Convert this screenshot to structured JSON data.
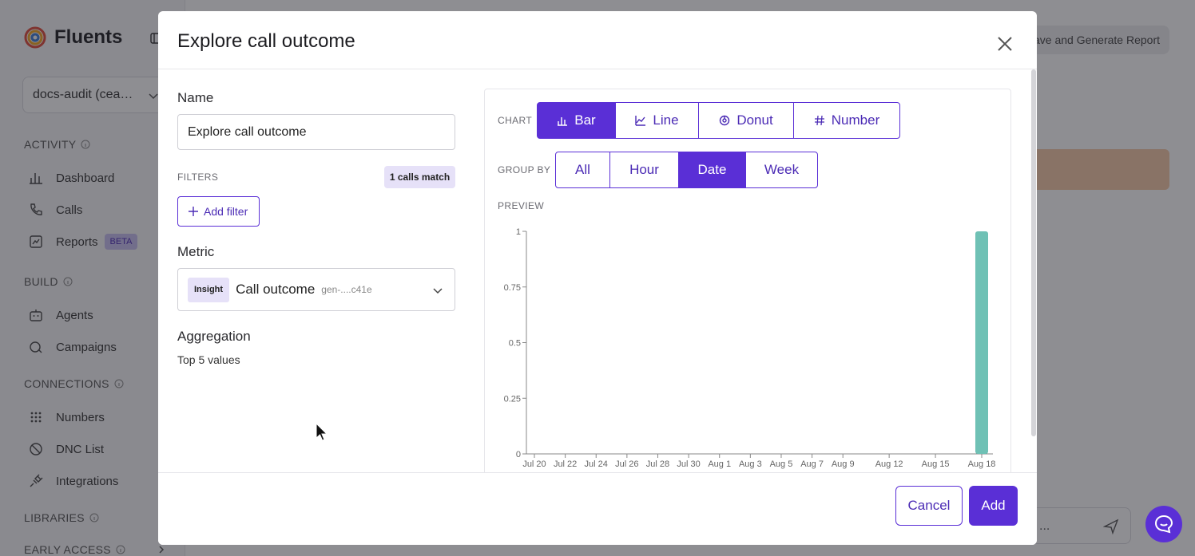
{
  "app": {
    "brand": "Fluents",
    "workspace": "docs-audit (cea…",
    "sections": [
      {
        "label": "ACTIVITY",
        "items": [
          {
            "label": "Dashboard"
          },
          {
            "label": "Calls"
          },
          {
            "label": "Reports",
            "badge": "BETA"
          }
        ]
      },
      {
        "label": "BUILD",
        "items": [
          {
            "label": "Agents"
          },
          {
            "label": "Campaigns"
          }
        ]
      },
      {
        "label": "CONNECTIONS",
        "items": [
          {
            "label": "Numbers"
          },
          {
            "label": "DNC List"
          },
          {
            "label": "Integrations"
          }
        ]
      },
      {
        "label": "LIBRARIES",
        "items": []
      },
      {
        "label": "EARLY ACCESS",
        "items": []
      }
    ],
    "header_button": "ave and Generate Report",
    "chat_input_placeholder": "..."
  },
  "modal": {
    "title": "Explore call outcome",
    "name_label": "Name",
    "name_value": "Explore call outcome",
    "filters_label": "FILTERS",
    "match_badge": "1 calls match",
    "add_filter_label": "Add filter",
    "metric_label": "Metric",
    "metric_tag": "Insight",
    "metric_name": "Call outcome",
    "metric_id": "gen-....c41e",
    "aggregation_label": "Aggregation",
    "aggregation_value": "Top 5 values",
    "chart_label": "CHART",
    "chart_types": [
      {
        "label": "Bar",
        "icon": "bar-chart-icon",
        "active": true
      },
      {
        "label": "Line",
        "icon": "line-chart-icon",
        "active": false
      },
      {
        "label": "Donut",
        "icon": "donut-chart-icon",
        "active": false
      },
      {
        "label": "Number",
        "icon": "hash-icon",
        "active": false
      }
    ],
    "group_by_label": "GROUP BY",
    "group_by": [
      {
        "label": "All",
        "active": false
      },
      {
        "label": "Hour",
        "active": false
      },
      {
        "label": "Date",
        "active": true
      },
      {
        "label": "Week",
        "active": false
      }
    ],
    "preview_label": "PREVIEW",
    "cancel_label": "Cancel",
    "add_label": "Add"
  },
  "colors": {
    "accent": "#5a2fd6",
    "bar": "#6fc1b5"
  },
  "chart_data": {
    "type": "bar",
    "x_ticks": [
      "Jul 20",
      "Jul 22",
      "Jul 24",
      "Jul 26",
      "Jul 28",
      "Jul 30",
      "Aug 1",
      "Aug 3",
      "Aug 5",
      "Aug 7",
      "Aug 9",
      "Aug 12",
      "Aug 15",
      "Aug 18"
    ],
    "y_ticks": [
      "0",
      "0.25",
      "0.5",
      "0.75",
      "1"
    ],
    "x_range": [
      "Jul 20",
      "Aug 18"
    ],
    "series": [
      {
        "x": "Aug 18",
        "y": 1
      }
    ],
    "ylim": [
      0,
      1
    ],
    "grid": false,
    "title": "",
    "xlabel": "",
    "ylabel": ""
  }
}
